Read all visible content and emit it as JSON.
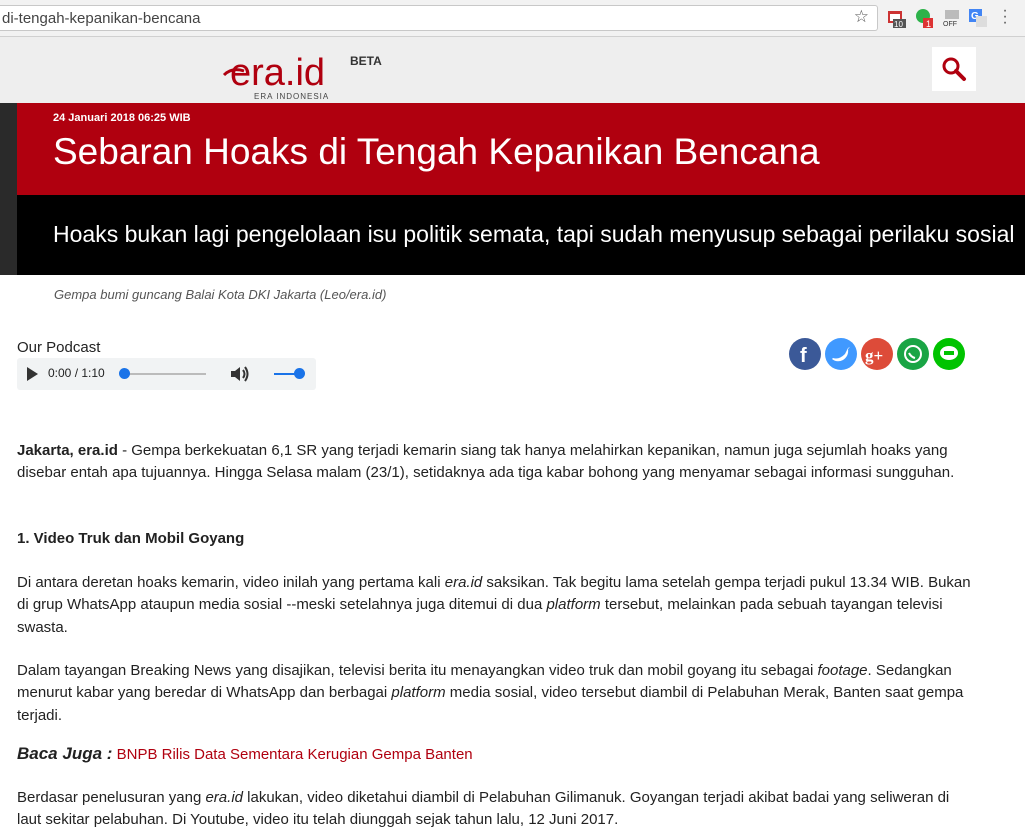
{
  "browser": {
    "url": "di-tengah-kepanikan-bencana",
    "star_icon": "star-icon",
    "ext_badge_1": "10",
    "ext_badge_2": "1",
    "ext_badge_3": "OFF"
  },
  "header": {
    "logo_main": "era.id",
    "logo_badge": "BETA",
    "logo_sub": "ERA INDONESIA",
    "search_icon": "search-icon"
  },
  "hero": {
    "date": "24 Januari 2018 06:25 WIB",
    "title": "Sebaran Hoaks di Tengah Kepanikan Bencana",
    "subtitle": "Hoaks bukan lagi pengelolaan isu politik semata, tapi sudah menyusup sebagai perilaku sosial"
  },
  "caption": "Gempa bumi guncang Balai Kota DKI Jakarta (Leo/era.id)",
  "podcast": {
    "label": "Our Podcast",
    "time": "0:00 / 1:10"
  },
  "social": [
    "facebook-icon",
    "twitter-icon",
    "google-plus-icon",
    "whatsapp-icon",
    "line-icon"
  ],
  "article": {
    "p1_lead": "Jakarta, era.id",
    "p1_rest": " - Gempa berkekuatan 6,1 SR yang terjadi kemarin siang tak hanya melahirkan kepanikan, namun juga sejumlah hoaks yang disebar entah apa tujuannya. Hingga Selasa malam (23/1), setidaknya ada tiga kabar bohong yang menyamar sebagai informasi sungguhan.",
    "heading1": "1. Video Truk dan Mobil Goyang",
    "p2_a": "Di antara deretan hoaks kemarin, video inilah yang pertama kali ",
    "p2_em1": "era.id",
    "p2_b": " saksikan. Tak begitu lama setelah gempa terjadi pukul 13.34 WIB. Bukan di grup WhatsApp ataupun media sosial --meski setelahnya juga ditemui di dua ",
    "p2_em2": "platform",
    "p2_c": " tersebut, melainkan pada sebuah tayangan televisi swasta.",
    "p3_a": "Dalam tayangan Breaking News yang disajikan, televisi berita itu menayangkan video truk dan mobil goyang itu sebagai ",
    "p3_em1": "footage",
    "p3_b": ". Sedangkan menurut kabar yang beredar di WhatsApp dan berbagai ",
    "p3_em2": "platform",
    "p3_c": " media sosial, video tersebut diambil di Pelabuhan Merak, Banten saat gempa terjadi.",
    "baca_label": "Baca Juga :",
    "baca_link": "BNPB Rilis Data Sementara Kerugian Gempa Banten",
    "p4_a": "Berdasar penelusuran yang ",
    "p4_em": "era.id",
    "p4_b": " lakukan, video diketahui diambil di Pelabuhan Gilimanuk. Goyangan terjadi akibat badai yang seliweran di laut sekitar pelabuhan. Di Youtube, video itu telah diunggah sejak tahun lalu, 12 Juni 2017."
  }
}
